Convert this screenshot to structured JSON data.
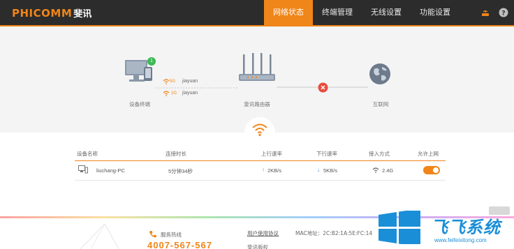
{
  "brand": {
    "logo_en": "PHICOMM",
    "logo_cn": "斐讯"
  },
  "nav": [
    {
      "label": "网络状态",
      "active": true
    },
    {
      "label": "终端管理",
      "active": false
    },
    {
      "label": "无线设置",
      "active": false
    },
    {
      "label": "功能设置",
      "active": false
    }
  ],
  "header_icons": [
    "router-icon",
    "help-icon"
  ],
  "topology": {
    "devices_label": "设备终端",
    "device_count": "1",
    "router_label": "斐讯路由器",
    "internet_label": "互联网",
    "wifi_5g": {
      "band": "5G",
      "ssid": "jiayuan"
    },
    "wifi_24g": {
      "band": "2G",
      "ssid": "jiayuan"
    },
    "internet_status": "disconnected"
  },
  "table": {
    "headers": [
      "设备名称",
      "连接时长",
      "上行速率",
      "下行速率",
      "接入方式",
      "允许上网"
    ],
    "rows": [
      {
        "name": "liuchang-PC",
        "duration": "5分钟34秒",
        "up": "2KB/s",
        "down": "5KB/s",
        "access": "2.4G",
        "allowed": true
      }
    ]
  },
  "footer": {
    "hotline_label": "服务热线",
    "hotline_number": "4007-567-567",
    "agreement": "用户使用协议",
    "mac": "MAC地址：2C:B2:1A:5E:FC:14",
    "company": "斐讯版权"
  },
  "watermark": {
    "text": "飞飞系统",
    "url": "www.feifeixitong.com"
  },
  "colors": {
    "accent": "#f08519",
    "header_bg": "#2c2c2c",
    "error": "#e84c3d"
  }
}
